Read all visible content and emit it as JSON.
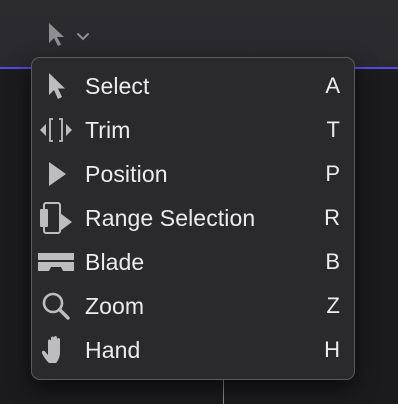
{
  "toolbar": {
    "tool_picker": {
      "icon": "select-arrow-icon",
      "chevron": "chevron-down-icon"
    }
  },
  "menu": {
    "items": [
      {
        "label": "Select",
        "shortcut": "A",
        "icon": "select-arrow-icon"
      },
      {
        "label": "Trim",
        "shortcut": "T",
        "icon": "trim-icon"
      },
      {
        "label": "Position",
        "shortcut": "P",
        "icon": "position-icon"
      },
      {
        "label": "Range Selection",
        "shortcut": "R",
        "icon": "range-selection-icon"
      },
      {
        "label": "Blade",
        "shortcut": "B",
        "icon": "blade-icon"
      },
      {
        "label": "Zoom",
        "shortcut": "Z",
        "icon": "magnifier-icon"
      },
      {
        "label": "Hand",
        "shortcut": "H",
        "icon": "hand-icon"
      }
    ]
  },
  "colors": {
    "accent_line": "#4f4be8",
    "menu_bg": "#2a2a2c",
    "text": "#ececec",
    "icon": "#b8b8b8"
  }
}
